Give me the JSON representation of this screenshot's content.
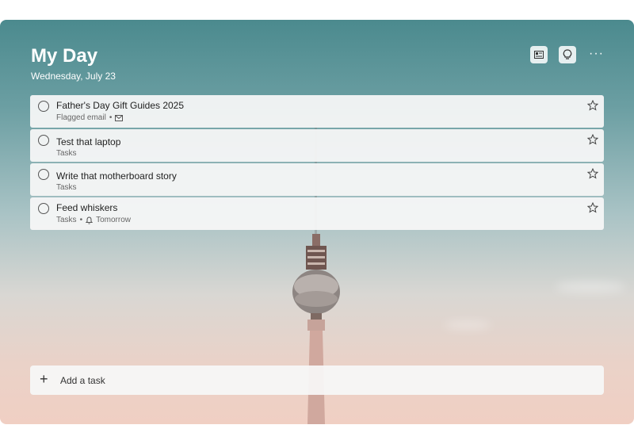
{
  "header": {
    "title": "My Day",
    "date": "Wednesday, July 23",
    "more_label": "···"
  },
  "tasks": [
    {
      "title": "Father's Day Gift Guides 2025",
      "subtitle": "Flagged email",
      "extra": "",
      "icon": "mail-icon"
    },
    {
      "title": "Test that laptop",
      "subtitle": "Tasks",
      "extra": "",
      "icon": ""
    },
    {
      "title": "Write that motherboard story",
      "subtitle": "Tasks",
      "extra": "",
      "icon": ""
    },
    {
      "title": "Feed whiskers",
      "subtitle": "Tasks",
      "extra": "Tomorrow",
      "icon": "bell-icon"
    }
  ],
  "add_task": {
    "label": "Add a task"
  },
  "icons": {
    "background": "background-image-icon",
    "suggestions": "lightbulb-icon",
    "more": "more-icon"
  },
  "colors": {
    "sky_top": "#4b8a8e",
    "sky_bottom": "#f0cfc3",
    "card": "#f7f7f7"
  }
}
